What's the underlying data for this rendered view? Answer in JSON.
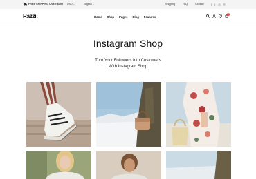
{
  "topbar": {
    "promo": "FREE SHIPPING OVER $100",
    "currency": "USD",
    "language": "English",
    "links": [
      "Shipping",
      "FAQ",
      "Contact"
    ],
    "social": [
      "f",
      "t",
      "◎",
      "℗"
    ]
  },
  "header": {
    "logo": "Razzi.",
    "nav": [
      {
        "label": "Home",
        "chev": ""
      },
      {
        "label": "Shop",
        "chev": ""
      },
      {
        "label": "Pages",
        "chev": ""
      },
      {
        "label": "Blog",
        "chev": ""
      },
      {
        "label": "Features",
        "chev": ""
      }
    ],
    "cart_count": "0"
  },
  "page": {
    "title": "Instagram Shop",
    "subtitle_line1": "Turn Your Followers Into Customers",
    "subtitle_line2": "With Instagram Shop"
  },
  "icons": {
    "search": "search-icon",
    "account": "user-icon",
    "wishlist": "heart-icon",
    "cart": "cart-icon"
  }
}
